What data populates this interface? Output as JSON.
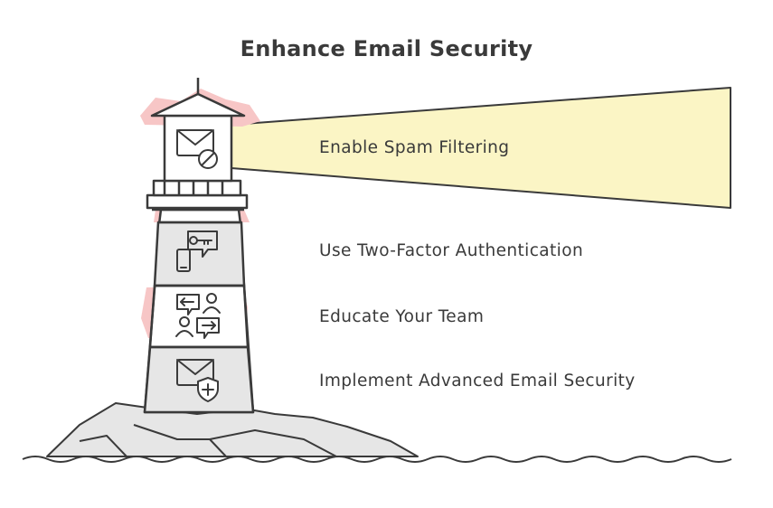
{
  "title": "Enhance Email Security",
  "steps": [
    {
      "label": "Enable Spam Filtering",
      "icon": "mail-blocked-icon"
    },
    {
      "label": "Use Two-Factor Authentication",
      "icon": "phone-key-icon"
    },
    {
      "label": "Educate Your Team",
      "icon": "people-exchange-icon"
    },
    {
      "label": "Implement Advanced Email Security",
      "icon": "mail-shield-icon"
    }
  ],
  "colors": {
    "beam": "#fbf5c5",
    "highlight": "#f7c6c6",
    "stone": "#e6e6e6",
    "stroke": "#3a3a3a"
  }
}
